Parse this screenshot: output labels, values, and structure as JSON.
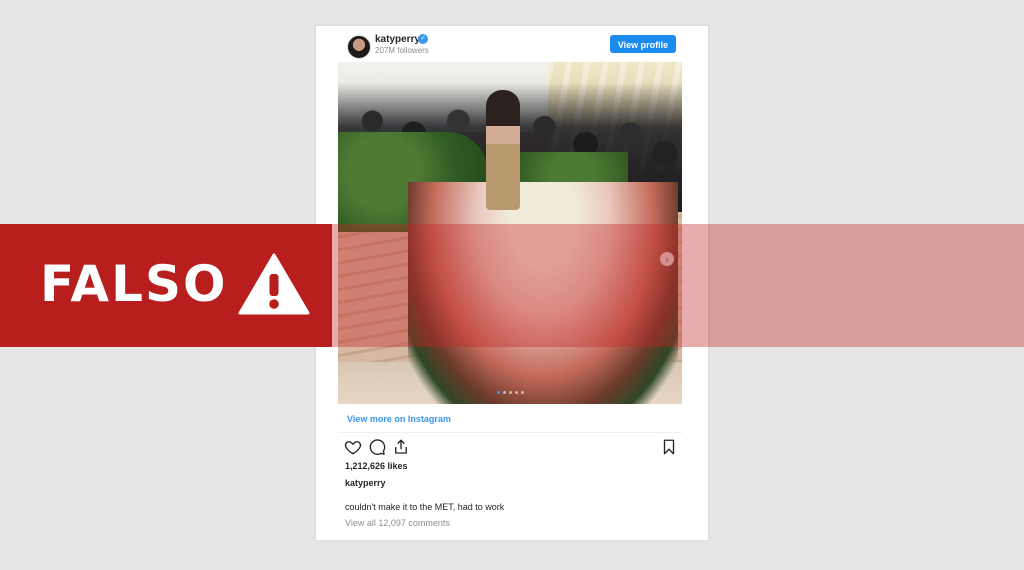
{
  "post": {
    "username": "katyperry",
    "followers": "207M followers",
    "view_profile_label": "View profile",
    "view_more_label": "View more on Instagram",
    "likes": "1,212,626 likes",
    "caption_user": "katyperry",
    "caption": "couldn't make it to the MET, had to work",
    "comments": "View all 12,097 comments",
    "carousel": {
      "total_slides": 5,
      "active_slide": 1
    }
  },
  "banner": {
    "label": "FALSO",
    "icon": "warning-icon"
  },
  "colors": {
    "background": "#e5e5e5",
    "banner_red": "#b81e1e",
    "instagram_blue": "#1a8cef"
  }
}
